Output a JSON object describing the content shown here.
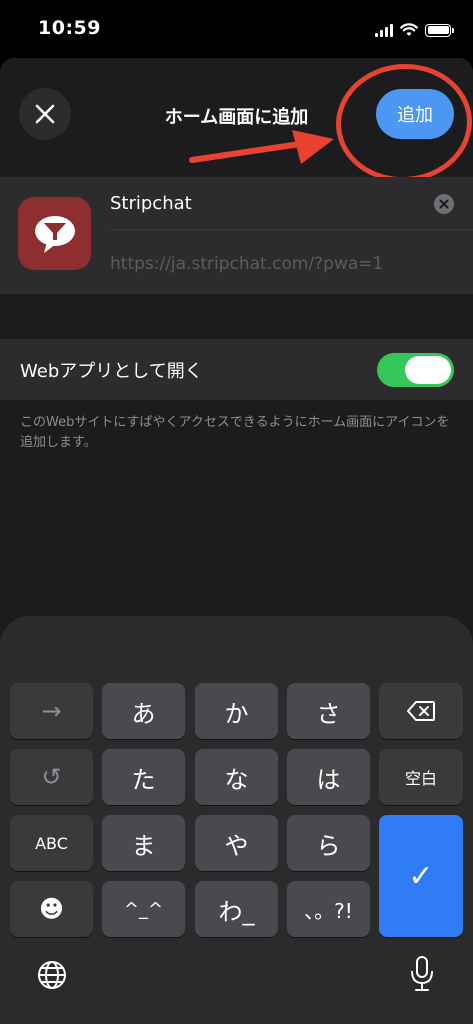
{
  "status": {
    "time": "10:59"
  },
  "header": {
    "title": "ホーム画面に追加",
    "add_label": "追加"
  },
  "app": {
    "name": "Stripchat",
    "url": "https://ja.stripchat.com/?pwa=1"
  },
  "webapp": {
    "label": "Webアプリとして開く",
    "toggle_on": true,
    "description": "このWebサイトにすばやくアクセスできるようにホーム画面にアイコンを追加します。"
  },
  "keyboard": {
    "row1": [
      "→",
      "あ",
      "か",
      "さ"
    ],
    "row2": [
      "↺",
      "た",
      "な",
      "は",
      "空白"
    ],
    "row3": [
      "ABC",
      "ま",
      "や",
      "ら"
    ],
    "row4": [
      "☻",
      "^_^",
      "わ_",
      "、。?!"
    ],
    "confirm": "✓",
    "delete_icon": "delete-icon",
    "globe_icon": "globe-icon",
    "mic_icon": "microphone-icon"
  },
  "colors": {
    "accent": "#4b97f3",
    "toggle_on": "#35c759",
    "annotation": "#e8432f",
    "return_key": "#2f7cf6"
  }
}
